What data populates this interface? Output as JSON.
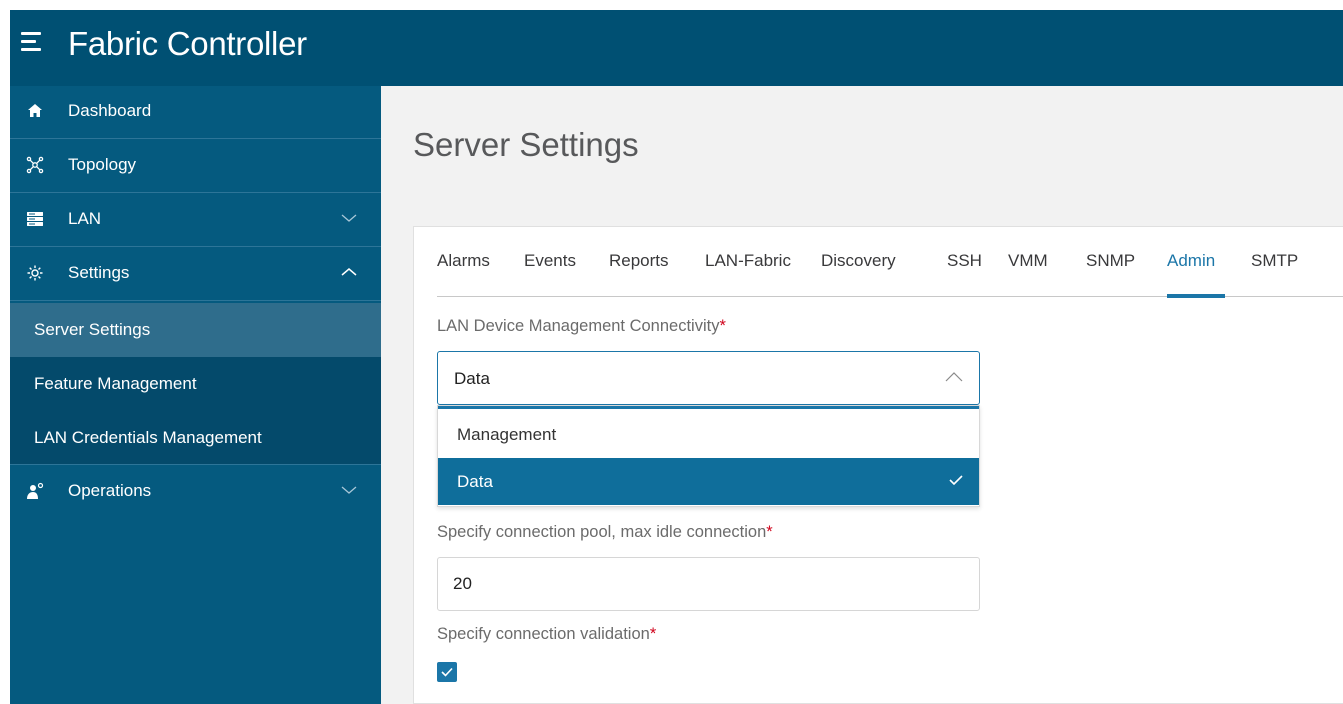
{
  "app": {
    "title": "Fabric Controller",
    "colors": {
      "header": "#005073",
      "sidebar": "#055a7f",
      "accent": "#1b76a8",
      "required": "#d0021b"
    }
  },
  "sidebar": {
    "items": [
      {
        "label": "Dashboard",
        "icon": "home-icon"
      },
      {
        "label": "Topology",
        "icon": "topology-icon"
      },
      {
        "label": "LAN",
        "icon": "server-icon",
        "expandable": true,
        "expanded": false
      },
      {
        "label": "Settings",
        "icon": "gear-icon",
        "expandable": true,
        "expanded": true
      },
      {
        "label": "Operations",
        "icon": "operations-icon",
        "expandable": true,
        "expanded": false
      }
    ],
    "settings_children": [
      {
        "label": "Server Settings",
        "active": true
      },
      {
        "label": "Feature Management",
        "active": false
      },
      {
        "label": "LAN Credentials Management",
        "active": false
      }
    ]
  },
  "page": {
    "title": "Server Settings"
  },
  "tabs": [
    {
      "label": "Alarms"
    },
    {
      "label": "Events"
    },
    {
      "label": "Reports"
    },
    {
      "label": "LAN-Fabric"
    },
    {
      "label": "Discovery"
    },
    {
      "label": "SSH"
    },
    {
      "label": "VMM"
    },
    {
      "label": "SNMP"
    },
    {
      "label": "Admin",
      "active": true
    },
    {
      "label": "SMTP"
    }
  ],
  "form": {
    "connectivity": {
      "label": "LAN Device Management Connectivity",
      "required_mark": "*",
      "value": "Data",
      "options": [
        {
          "label": "Management",
          "selected": false
        },
        {
          "label": "Data",
          "selected": true
        }
      ]
    },
    "pool": {
      "label": "Specify connection pool, max idle connection",
      "required_mark": "*",
      "value": "20"
    },
    "validation": {
      "label": "Specify connection validation",
      "required_mark": "*",
      "checked": true
    }
  }
}
